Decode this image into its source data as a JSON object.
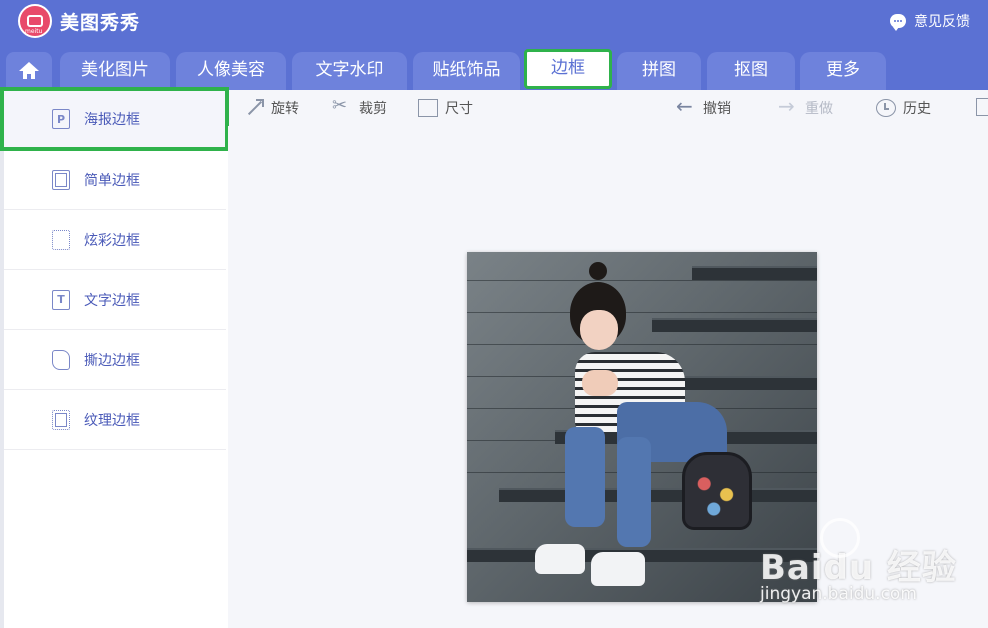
{
  "app": {
    "title": "美图秀秀",
    "logo_text": "meitu",
    "feedback_label": "意见反馈"
  },
  "tabs": [
    {
      "label": "美化图片"
    },
    {
      "label": "人像美容"
    },
    {
      "label": "文字水印"
    },
    {
      "label": "贴纸饰品"
    },
    {
      "label": "边框",
      "active": true
    },
    {
      "label": "拼图"
    },
    {
      "label": "抠图"
    },
    {
      "label": "更多"
    }
  ],
  "sidebar": {
    "items": [
      {
        "label": "海报边框",
        "icon": "p-icon",
        "selected": true
      },
      {
        "label": "简单边框",
        "icon": "simple-frame-icon"
      },
      {
        "label": "炫彩边框",
        "icon": "dotted-frame-icon"
      },
      {
        "label": "文字边框",
        "icon": "t-icon"
      },
      {
        "label": "撕边边框",
        "icon": "torn-frame-icon"
      },
      {
        "label": "纹理边框",
        "icon": "texture-frame-icon"
      }
    ]
  },
  "toolbar": {
    "rotate": "旋转",
    "crop": "裁剪",
    "size": "尺寸",
    "undo": "撤销",
    "redo": "重做",
    "history": "历史"
  },
  "watermark": {
    "main": "Baidu 经验",
    "sub": "jingyan.baidu.com"
  },
  "colors": {
    "header": "#5b71d3",
    "tab": "#6e82dc",
    "highlight": "#2fb24b",
    "text_accent": "#4a5ab8"
  }
}
